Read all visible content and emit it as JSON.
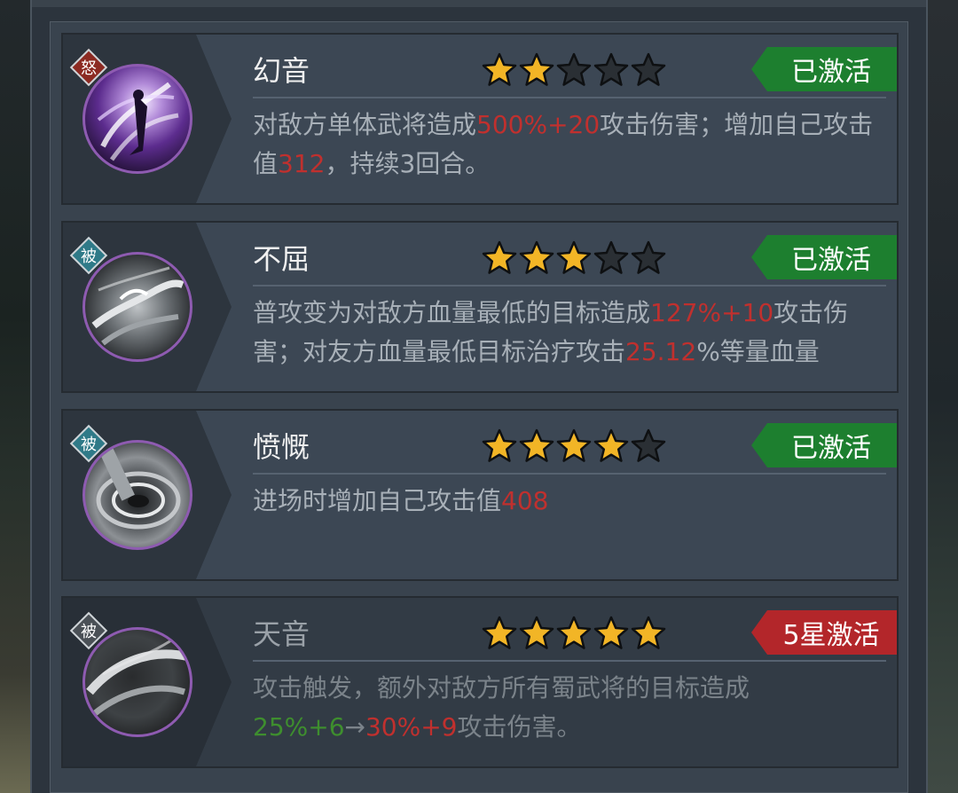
{
  "skills": [
    {
      "tag": "怒",
      "tag_color": "#8c2a22",
      "name": "幻音",
      "stars": 2,
      "status": "已激活",
      "status_color": "green",
      "desc": [
        {
          "t": "对敌方单体武将造成",
          "c": "normal"
        },
        {
          "t": "500%+20",
          "c": "red"
        },
        {
          "t": "攻击伤害；增加自己攻击值",
          "c": "normal"
        },
        {
          "t": "312",
          "c": "red"
        },
        {
          "t": "，持续3回合。",
          "c": "normal"
        }
      ]
    },
    {
      "tag": "被",
      "tag_color": "#2f7a88",
      "name": "不屈",
      "stars": 3,
      "status": "已激活",
      "status_color": "green",
      "desc": [
        {
          "t": "普攻变为对敌方血量最低的目标造成",
          "c": "normal"
        },
        {
          "t": "127%+10",
          "c": "red"
        },
        {
          "t": "攻击伤害；对友方血量最低目标治疗攻击",
          "c": "normal"
        },
        {
          "t": "25.12",
          "c": "red"
        },
        {
          "t": "%等量血量",
          "c": "normal"
        }
      ]
    },
    {
      "tag": "被",
      "tag_color": "#2f7a88",
      "name": "愤慨",
      "stars": 4,
      "status": "已激活",
      "status_color": "green",
      "desc": [
        {
          "t": "进场时增加自己攻击值",
          "c": "normal"
        },
        {
          "t": "408",
          "c": "red"
        }
      ]
    },
    {
      "tag": "被",
      "tag_color": "#4a5056",
      "name": "天音",
      "stars": 5,
      "status": "5星激活",
      "status_color": "red",
      "inactive": true,
      "desc": [
        {
          "t": "攻击触发，额外对敌方所有蜀武将的目标造成",
          "c": "normal"
        },
        {
          "t": "25%+6",
          "c": "green"
        },
        {
          "t": "→",
          "c": "normal"
        },
        {
          "t": "30%+9",
          "c": "red"
        },
        {
          "t": "攻击伤害。",
          "c": "normal"
        }
      ]
    }
  ],
  "colors": {
    "star_gold": "#f2b526",
    "star_empty": "#2a2f34",
    "badge_green": "#1d7f2f",
    "badge_red": "#b3262a",
    "highlight_red": "#c0302e",
    "highlight_green": "#3e8e2e"
  }
}
